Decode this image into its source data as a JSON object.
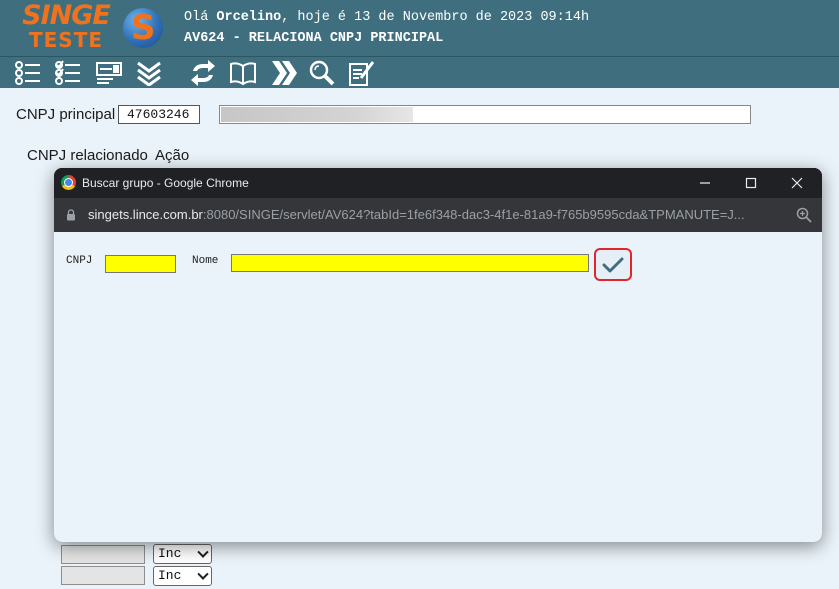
{
  "header": {
    "logo_line1": "SINGE",
    "logo_line2": "TESTE",
    "logo_mark": "S",
    "greeting_prefix": "Olá ",
    "user_name": "Orcelino",
    "greeting_suffix": ", hoje é 13 de Novembro de 2023 09:14h",
    "program_title": "AV624 - RELACIONA CNPJ PRINCIPAL",
    "colors": {
      "bar": "#3f6f7f",
      "logo": "#f0721c"
    }
  },
  "toolbar": {
    "buttons": [
      {
        "icon": "list-icon"
      },
      {
        "icon": "checklist-icon"
      },
      {
        "icon": "form-icon"
      },
      {
        "icon": "double-chevron-down-icon"
      },
      {
        "icon": "refresh-icon"
      },
      {
        "icon": "book-icon"
      },
      {
        "icon": "double-chevron-right-icon"
      },
      {
        "icon": "search-icon"
      },
      {
        "icon": "edit-document-icon"
      }
    ]
  },
  "main": {
    "cnpj_principal_label": "CNPJ principal",
    "cnpj_principal_value": "47603246",
    "col_cnpj_relacionado": "CNPJ relacionado",
    "col_acao": "Ação",
    "rows": [
      {
        "cnpj": "",
        "acao": "Inc"
      },
      {
        "cnpj": "",
        "acao": "Inc"
      }
    ]
  },
  "popup": {
    "window_title": "Buscar grupo - Google Chrome",
    "url_host": "singets.lince.com.br",
    "url_rest": ":8080/SINGE/servlet/AV624?tabId=1fe6f348-dac3-4f1e-81a9-f765b9595cda&TPMANUTE=J...",
    "cnpj_label": "CNPJ",
    "nome_label": "Nome",
    "cnpj_value": "",
    "nome_value": "",
    "highlight_color": "#e0262b",
    "input_color": "#ffff00"
  }
}
